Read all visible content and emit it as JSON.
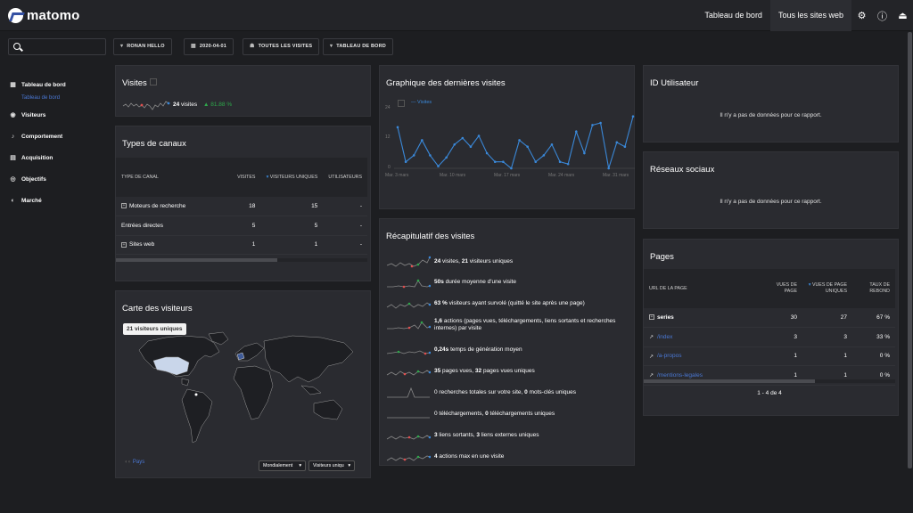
{
  "app": {
    "logo": "matomo"
  },
  "topnav": {
    "dashboard": "Tableau de bord",
    "all_sites": "Tous les sites web",
    "icons": [
      "gear-icon",
      "info-icon",
      "logout-icon"
    ]
  },
  "filters": {
    "user": "RONAN HELLO",
    "date": "2020-04-01",
    "segment": "TOUTES LES VISITES",
    "dashboard": "TABLEAU DE BORD"
  },
  "sidebar": {
    "items": [
      {
        "label": "Tableau de bord",
        "icon": "grid-icon"
      },
      {
        "label": "Visiteurs",
        "icon": "eye-icon"
      },
      {
        "label": "Comportement",
        "icon": "bell-icon"
      },
      {
        "label": "Acquisition",
        "icon": "download-icon"
      },
      {
        "label": "Objectifs",
        "icon": "target-icon"
      },
      {
        "label": "Marché",
        "icon": "cart-icon"
      }
    ],
    "active_sub": "Tableau de bord"
  },
  "visits_widget": {
    "title": "Visites",
    "count": "24",
    "label": "visites",
    "change": "81.88 %"
  },
  "channels": {
    "title": "Types de canaux",
    "headers": [
      "TYPE DE CANAL",
      "VISITES",
      "VISITEURS UNIQUES",
      "UTILISATEURS"
    ],
    "rows": [
      {
        "label": "Moteurs de recherche",
        "visits": "18",
        "unique": "15",
        "users": "-",
        "expandable": true
      },
      {
        "label": "Entrées directes",
        "visits": "5",
        "unique": "5",
        "users": "-",
        "expandable": false
      },
      {
        "label": "Sites web",
        "visits": "1",
        "unique": "1",
        "users": "-",
        "expandable": true
      }
    ]
  },
  "map": {
    "title": "Carte des visiteurs",
    "tooltip": "21 visiteurs uniques",
    "legend": "Pays",
    "select_region": "Mondialement",
    "select_metric": "Visiteurs uniqu"
  },
  "graph": {
    "title": "Graphique des dernières visites",
    "legend": "Visites",
    "chart_data": {
      "type": "line",
      "x": [
        "2020-03-03",
        "2020-03-04",
        "2020-03-05",
        "2020-03-06",
        "2020-03-07",
        "2020-03-08",
        "2020-03-09",
        "2020-03-10",
        "2020-03-11",
        "2020-03-12",
        "2020-03-13",
        "2020-03-14",
        "2020-03-15",
        "2020-03-16",
        "2020-03-17",
        "2020-03-18",
        "2020-03-19",
        "2020-03-20",
        "2020-03-21",
        "2020-03-22",
        "2020-03-23",
        "2020-03-24",
        "2020-03-25",
        "2020-03-26",
        "2020-03-27",
        "2020-03-28",
        "2020-03-29",
        "2020-03-30",
        "2020-03-31",
        "2020-04-01"
      ],
      "series": [
        {
          "name": "Visites",
          "values": [
            19,
            3,
            6,
            13,
            6,
            1,
            5,
            11,
            14,
            10,
            15,
            7,
            3,
            3,
            0,
            13,
            10,
            3,
            6,
            11,
            3,
            2,
            17,
            7,
            20,
            21,
            0,
            12,
            10,
            24
          ]
        }
      ],
      "yticks": [
        "0",
        "12",
        "24"
      ],
      "ylim": [
        0,
        28
      ],
      "xticks": [
        "Mar. 3 mars",
        "Mar. 10 mars",
        "Mar. 17 mars",
        "Mar. 24 mars",
        "Mar. 31 mars"
      ],
      "color": "#3a88d8"
    }
  },
  "summary": {
    "title": "Récapitulatif des visites",
    "rows": [
      {
        "b1": "24",
        "t1": " visites, ",
        "b2": "21",
        "t2": " visiteurs uniques"
      },
      {
        "b1": "50s",
        "t1": " durée moyenne d'une visite",
        "b2": "",
        "t2": ""
      },
      {
        "b1": "63 %",
        "t1": " visiteurs ayant survolé (quitté le site après une page)",
        "b2": "",
        "t2": ""
      },
      {
        "b1": "1,6",
        "t1": " actions (pages vues, téléchargements, liens sortants et recherches internes) par visite",
        "b2": "",
        "t2": ""
      },
      {
        "b1": "0,24s",
        "t1": " temps de génération moyen",
        "b2": "",
        "t2": ""
      },
      {
        "b1": "35",
        "t1": " pages vues, ",
        "b2": "32",
        "t2": " pages vues uniques"
      },
      {
        "b1": "",
        "t1": "0 recherches totales sur votre site, ",
        "b2": "0",
        "t2": " mots-clés uniques"
      },
      {
        "b1": "",
        "t1": "0 téléchargements, ",
        "b2": "0",
        "t2": " téléchargements uniques"
      },
      {
        "b1": "3",
        "t1": " liens sortants, ",
        "b2": "3",
        "t2": " liens externes uniques"
      },
      {
        "b1": "4",
        "t1": " actions max en une visite",
        "b2": "",
        "t2": ""
      }
    ]
  },
  "user_id": {
    "title": "ID Utilisateur",
    "message": "Il n'y a pas de données pour ce rapport."
  },
  "social": {
    "title": "Réseaux sociaux",
    "message": "Il n'y a pas de données pour ce rapport."
  },
  "pages": {
    "title": "Pages",
    "headers": [
      "URL DE LA PAGE",
      "VUES DE PAGE",
      "VUES DE PAGE UNIQUES",
      "TAUX DE REBOND"
    ],
    "rows": [
      {
        "label": "series",
        "views": "30",
        "unique": "27",
        "bounce": "67 %",
        "kind": "folder"
      },
      {
        "label": "/index",
        "views": "3",
        "unique": "3",
        "bounce": "33 %",
        "kind": "link"
      },
      {
        "label": "/a-propos",
        "views": "1",
        "unique": "1",
        "bounce": "0 %",
        "kind": "link"
      },
      {
        "label": "/mentions-legales",
        "views": "1",
        "unique": "1",
        "bounce": "0 %",
        "kind": "link"
      }
    ],
    "pagination": "1 - 4 de 4"
  }
}
